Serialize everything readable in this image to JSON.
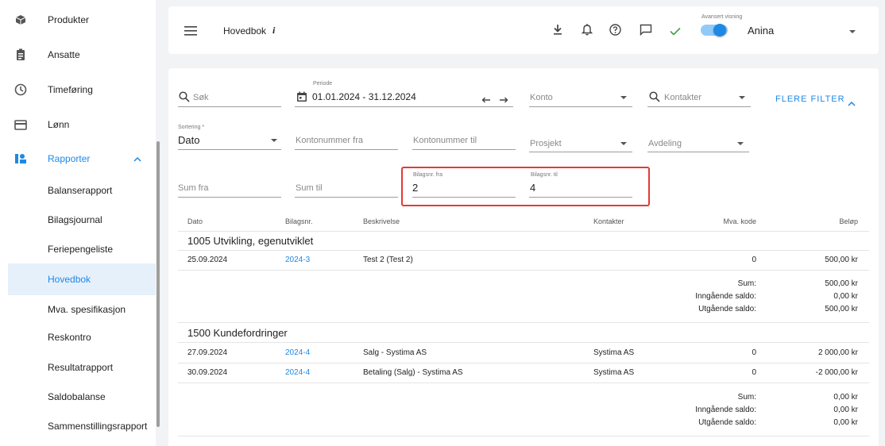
{
  "sidebar": {
    "items": [
      {
        "label": "Produkter",
        "icon": "box-icon"
      },
      {
        "label": "Ansatte",
        "icon": "badge-icon"
      },
      {
        "label": "Timeføring",
        "icon": "clock-icon"
      },
      {
        "label": "Lønn",
        "icon": "card-icon"
      },
      {
        "label": "Rapporter",
        "icon": "report-icon"
      }
    ],
    "sub_items": [
      "Balanserapport",
      "Bilagsjournal",
      "Feriepengeliste",
      "Hovedbok",
      "Mva. spesifikasjon",
      "Reskontro",
      "Resultatrapport",
      "Saldobalanse",
      "Sammenstillingsrapport"
    ],
    "active": "Hovedbok"
  },
  "topbar": {
    "title": "Hovedbok",
    "info": "i",
    "toggle_label": "Avansert visning",
    "toggle_on": true,
    "user": "Anina",
    "accent": "#1e88e5"
  },
  "filters": {
    "search_placeholder": "Søk",
    "periode_label": "Periode",
    "periode_value": "01.01.2024 - 31.12.2024",
    "konto_placeholder": "Konto",
    "kontakter_placeholder": "Kontakter",
    "flere_filter": "FLERE FILTER",
    "sortering_label": "Sortering *",
    "sortering_value": "Dato",
    "kontonummer_fra": "Kontonummer fra",
    "kontonummer_til": "Kontonummer til",
    "prosjekt": "Prosjekt",
    "avdeling": "Avdeling",
    "sum_fra": "Sum fra",
    "sum_til": "Sum til",
    "bilagsnr_fra_label": "Bilagsnr. fra",
    "bilagsnr_fra_value": "2",
    "bilagsnr_til_label": "Bilagsnr. til",
    "bilagsnr_til_value": "4",
    "highlight_color": "#e53935"
  },
  "table": {
    "headers": [
      "Dato",
      "Bilagsnr.",
      "Beskrivelse",
      "Kontakter",
      "Mva. kode",
      "Beløp"
    ],
    "groups": [
      {
        "title": "1005 Utvikling, egenutviklet",
        "rows": [
          {
            "dato": "25.09.2024",
            "bilag": "2024-3",
            "beskrivelse": "Test 2 (Test 2)",
            "kontakt": "",
            "mva": "0",
            "belop": "500,00 kr"
          }
        ],
        "summary": {
          "sum_label": "Sum:",
          "sum": "500,00 kr",
          "inn_label": "Inngående saldo:",
          "inn": "0,00 kr",
          "ut_label": "Utgående saldo:",
          "ut": "500,00 kr"
        }
      },
      {
        "title": "1500 Kundefordringer",
        "rows": [
          {
            "dato": "27.09.2024",
            "bilag": "2024-4",
            "beskrivelse": "Salg - Systima AS",
            "kontakt": "Systima AS",
            "mva": "0",
            "belop": "2 000,00 kr"
          },
          {
            "dato": "30.09.2024",
            "bilag": "2024-4",
            "beskrivelse": "Betaling (Salg) - Systima AS",
            "kontakt": "Systima AS",
            "mva": "0",
            "belop": "-2 000,00 kr"
          }
        ],
        "summary": {
          "sum_label": "Sum:",
          "sum": "0,00 kr",
          "inn_label": "Inngående saldo:",
          "inn": "0,00 kr",
          "ut_label": "Utgående saldo:",
          "ut": "0,00 kr"
        }
      }
    ]
  }
}
